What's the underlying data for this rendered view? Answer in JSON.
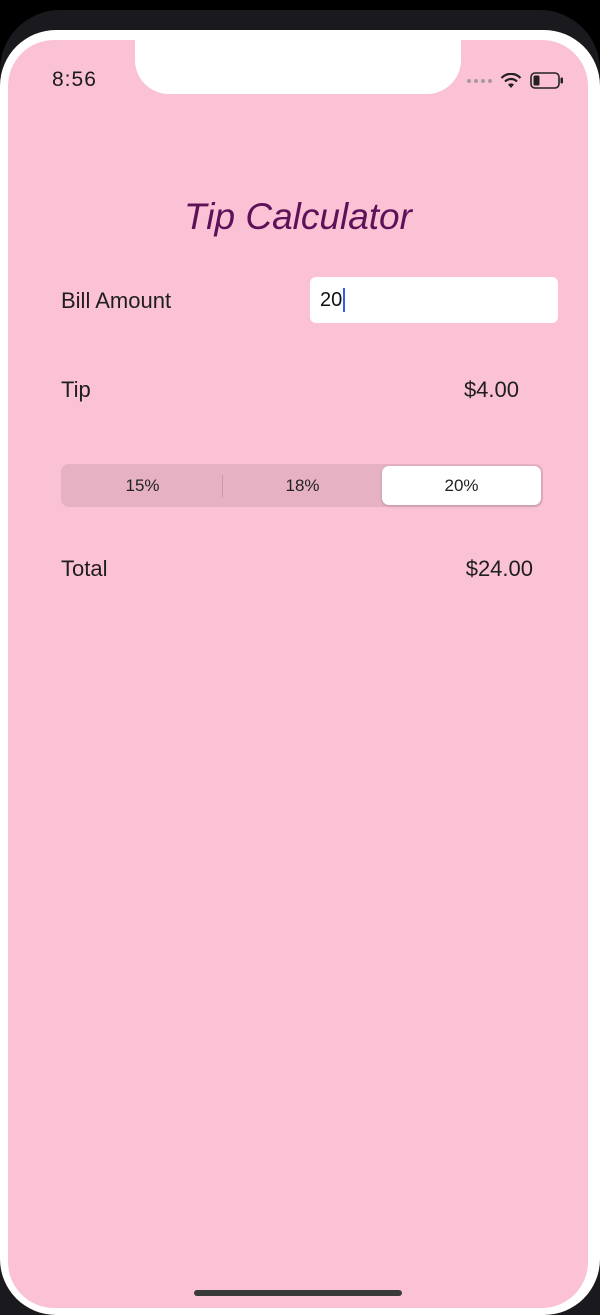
{
  "status_bar": {
    "time": "8:56"
  },
  "app": {
    "title": "Tip Calculator"
  },
  "bill": {
    "label": "Bill Amount",
    "value": "20"
  },
  "tip": {
    "label": "Tip",
    "value": "$4.00"
  },
  "tip_options": {
    "segments": [
      "15%",
      "18%",
      "20%"
    ],
    "selected": "20%"
  },
  "total": {
    "label": "Total",
    "value": "$24.00"
  },
  "colors": {
    "background": "#fbc2d5",
    "title": "#5d1158",
    "cursor": "#3c5ae8"
  }
}
